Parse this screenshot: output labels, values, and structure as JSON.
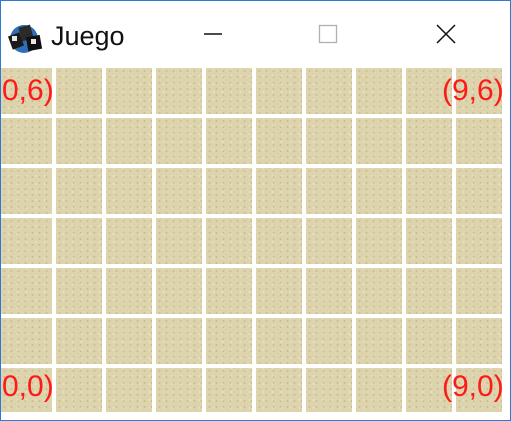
{
  "window": {
    "title": "Juego",
    "accent_color": "#2b7bd3",
    "icons": {
      "app": "game-app-icon",
      "minimize": "minimize-icon",
      "maximize": "maximize-icon",
      "close": "close-icon"
    }
  },
  "board": {
    "columns": 10,
    "rows": 7,
    "tile_color": "#ddd3ac",
    "label_color": "#ff1a1a",
    "labels": {
      "top_left": "0,6)",
      "top_right": "(9,6)",
      "bottom_left": "0,0)",
      "bottom_right": "(9,0)"
    }
  }
}
